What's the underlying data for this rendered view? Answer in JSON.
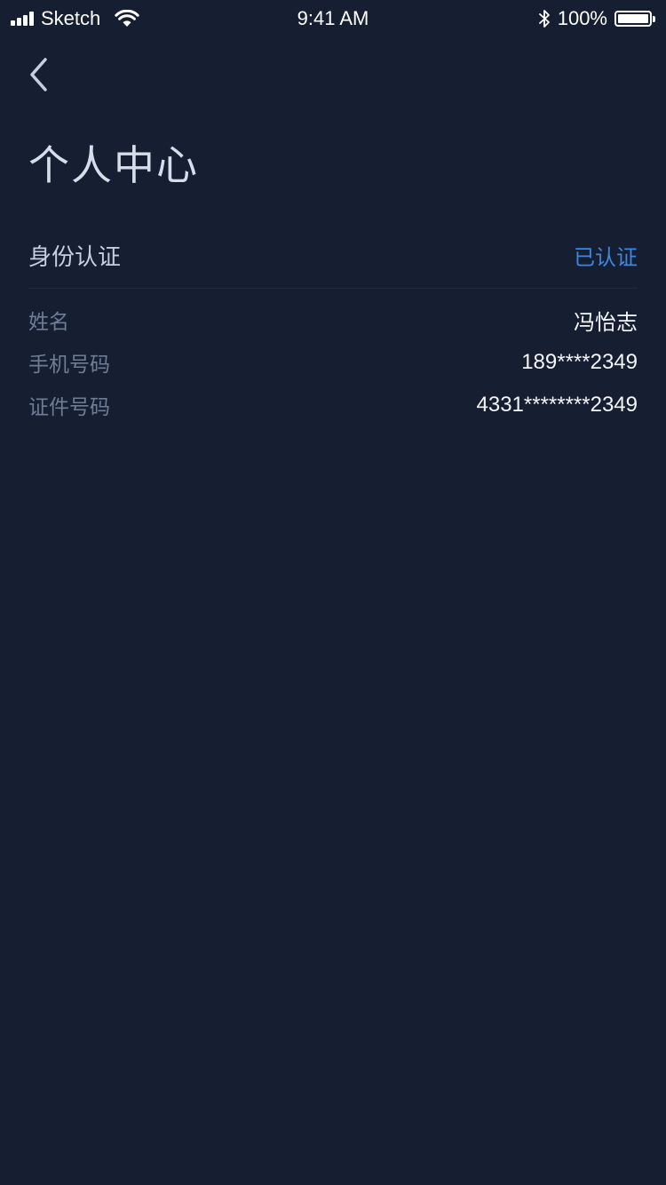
{
  "status_bar": {
    "carrier": "Sketch",
    "time": "9:41 AM",
    "battery": "100%",
    "battery_level": 1.0,
    "icons": [
      "signal-bars-icon",
      "wifi-icon",
      "bluetooth-icon",
      "battery-icon"
    ]
  },
  "nav": {
    "back_icon": "chevron-left-icon"
  },
  "page": {
    "title": "个人中心"
  },
  "identity": {
    "title": "身份认证",
    "status": "已认证",
    "status_color": "#3f86e0",
    "rows": [
      {
        "label": "姓名",
        "value": "冯怡志"
      },
      {
        "label": "手机号码",
        "value": "189****2349"
      },
      {
        "label": "证件号码",
        "value": "4331********2349"
      }
    ]
  },
  "colors": {
    "background": "#161f31",
    "title": "#d6deeb",
    "label": "#6f7c95",
    "value": "#f2f5fa"
  }
}
